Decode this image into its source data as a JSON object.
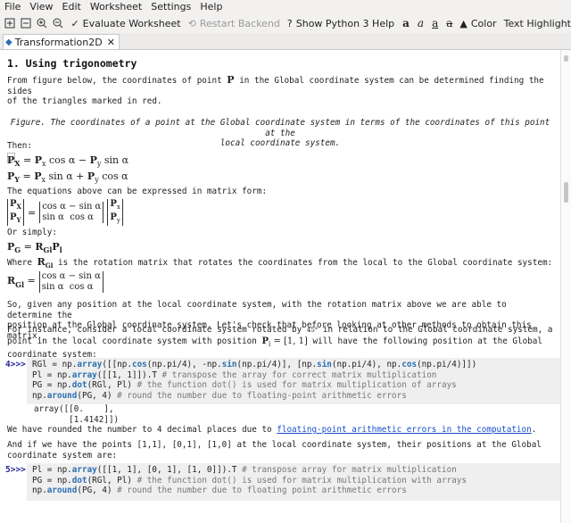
{
  "menu": [
    "File",
    "View",
    "Edit",
    "Worksheet",
    "Settings",
    "Help"
  ],
  "toolbar": {
    "evaluate": "Evaluate Worksheet",
    "restart": "Restart Backend",
    "help": "Show Python 3 Help",
    "format_glyphs": [
      "a",
      "a",
      "a",
      "a"
    ],
    "color": "Color",
    "highlight": "Text Highlight"
  },
  "tab": {
    "title": "Transformation2D"
  },
  "doc": {
    "heading": "1. Using trigonometry",
    "intro_l1": "From figure below, the coordinates of point",
    "intro_P": "P",
    "intro_l1b": "in the Global coordinate system can be determined finding the sides",
    "intro_l2": "of the triangles marked in red.",
    "caption_l1": "Figure. The coordinates of a point at the Global coordinate system in terms of the coordinates of this point at the",
    "caption_l2": "local coordinate system.",
    "then": "Then:",
    "eq1": "P_X = P_x cos α − P_y sin α",
    "eq2": "P_Y = P_x sin α + P_y cos α",
    "matrix_text": "The equations above can be expressed in matrix form:",
    "simply": "Or simply:",
    "eq3": "P_G = R_Gl P_l",
    "where_a": "Where",
    "where_R": "R_Gl",
    "where_b": "is the rotation matrix that rotates the coordinates from the local to the Global coordinate system:",
    "para1_l1": "So, given any position at the local coordinate system, with the rotation matrix above we are able to determine the",
    "para1_l2": "position at the Global coordinate system. Let's check that before looking at other methods to obtain this matrix.",
    "para2_l1": "For instance, consider a local coordinate system rotated by",
    "para2_deg": "45°",
    "para2_l1b": "in relation to the Global coordinate system, a",
    "para2_l2a": "point in the local coordinate system with position",
    "para2_pos": "P_l = [1, 1]",
    "para2_l2b": "will have the following position at the Global",
    "para2_l3": "coordinate system:",
    "cell4_prompt": "4>>>",
    "cell4_code": [
      "RGl = np.array([[np.cos(np.pi/4), -np.sin(np.pi/4)], [np.sin(np.pi/4), np.cos(np.pi/4)]])",
      "Pl  = np.array([[1, 1]]).T  # transpose the array for correct matrix multiplication",
      "PG  = np.dot(RGl, Pl)       # the function dot() is used for matrix multiplication of arrays",
      "np.around(PG, 4)            # round the number due to floating-point arithmetic errors"
    ],
    "cell4_out": [
      "array([[0.    ],",
      "       [1.4142]])"
    ],
    "rounded_a": "We have rounded the number to 4 decimal places due to",
    "rounded_link": "floating-point arithmetic errors in the computation",
    "rounded_b": ".",
    "points_l1": "And if we have the points [1,1], [0,1], [1,0] at the local coordinate system, their positions at the Global",
    "points_l2": "coordinate system are:",
    "cell5_prompt": "5>>>",
    "cell5_code": [
      "Pl = np.array([[1, 1], [0, 1], [1, 0]]).T  # transpose array for matrix multiplication",
      "PG = np.dot(RGl, Pl)  # the function dot() is used for matrix multiplication with arrays",
      "np.around(PG, 4)      # round the number due to floating point arithmetic errors"
    ]
  }
}
